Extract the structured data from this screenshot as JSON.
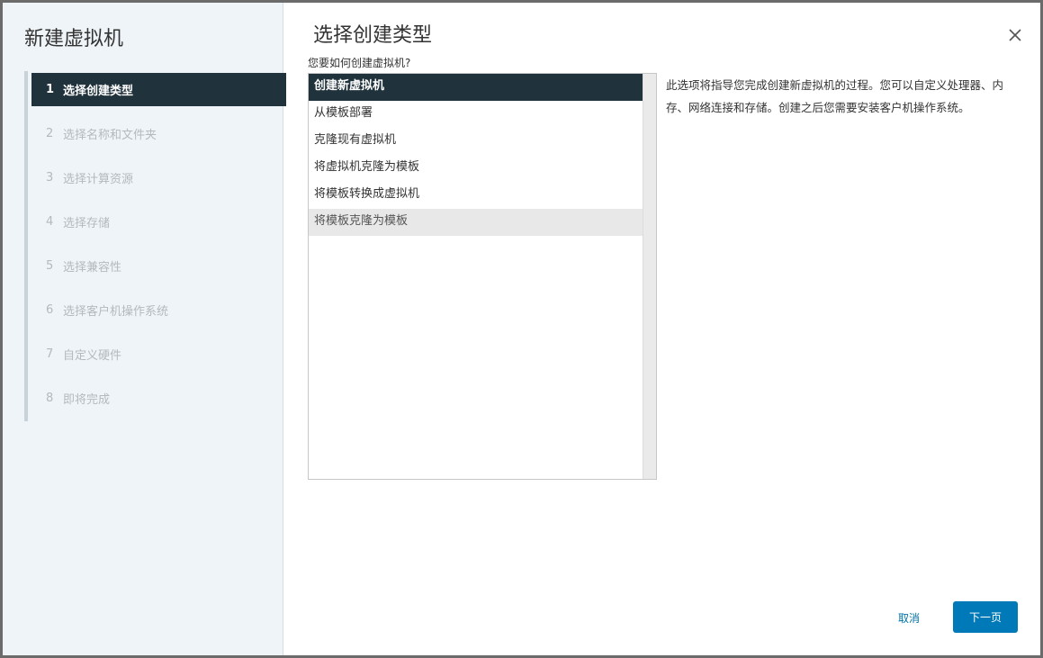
{
  "wizard": {
    "title": "新建虚拟机",
    "steps": [
      {
        "num": "1",
        "label": "选择创建类型",
        "active": true
      },
      {
        "num": "2",
        "label": "选择名称和文件夹",
        "active": false
      },
      {
        "num": "3",
        "label": "选择计算资源",
        "active": false
      },
      {
        "num": "4",
        "label": "选择存储",
        "active": false
      },
      {
        "num": "5",
        "label": "选择兼容性",
        "active": false
      },
      {
        "num": "6",
        "label": "选择客户机操作系统",
        "active": false
      },
      {
        "num": "7",
        "label": "自定义硬件",
        "active": false
      },
      {
        "num": "8",
        "label": "即将完成",
        "active": false
      }
    ]
  },
  "main": {
    "title": "选择创建类型",
    "question": "您要如何创建虚拟机?",
    "options": [
      {
        "label": "创建新虚拟机",
        "state": "selected"
      },
      {
        "label": "从模板部署",
        "state": "normal"
      },
      {
        "label": "克隆现有虚拟机",
        "state": "normal"
      },
      {
        "label": "将虚拟机克隆为模板",
        "state": "normal"
      },
      {
        "label": "将模板转换成虚拟机",
        "state": "normal"
      },
      {
        "label": "将模板克隆为模板",
        "state": "hovered"
      }
    ],
    "description": "此选项将指导您完成创建新虚拟机的过程。您可以自定义处理器、内存、网络连接和存储。创建之后您需要安装客户机操作系统。"
  },
  "footer": {
    "cancel_label": "取消",
    "next_label": "下一页"
  },
  "icons": {
    "close": "close-icon"
  },
  "colors": {
    "selected_bg": "#20323c",
    "primary_button": "#0079b8",
    "link": "#0072a3",
    "sidebar_bg": "#eef4f7"
  }
}
